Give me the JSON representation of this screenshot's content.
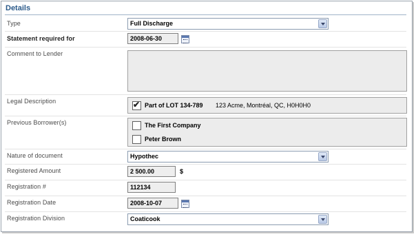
{
  "section_title": "Details",
  "fields": {
    "type": {
      "label": "Type",
      "value": "Full Discharge"
    },
    "statement_required_for": {
      "label": "Statement required for",
      "value": "2008-06-30"
    },
    "comment_to_lender": {
      "label": "Comment to Lender",
      "value": ""
    },
    "legal_description": {
      "label": "Legal Description",
      "option": {
        "checked": true,
        "label": "Part of LOT 134-789",
        "detail": "123 Acme, Montréal, QC, H0H0H0"
      }
    },
    "previous_borrowers": {
      "label": "Previous Borrower(s)",
      "options": [
        {
          "checked": false,
          "label": "The First Company"
        },
        {
          "checked": false,
          "label": "Peter Brown"
        }
      ]
    },
    "nature_of_document": {
      "label": "Nature of document",
      "value": "Hypothec"
    },
    "registered_amount": {
      "label": "Registered Amount",
      "value": "2 500.00",
      "unit": "$"
    },
    "registration_number": {
      "label": "Registration #",
      "value": "112134"
    },
    "registration_date": {
      "label": "Registration Date",
      "value": "2008-10-07"
    },
    "registration_division": {
      "label": "Registration Division",
      "value": "Coaticook"
    }
  },
  "icons": {
    "dropdown": "chevron-down-icon",
    "calendar": "calendar-icon",
    "checkmark": "✔"
  }
}
